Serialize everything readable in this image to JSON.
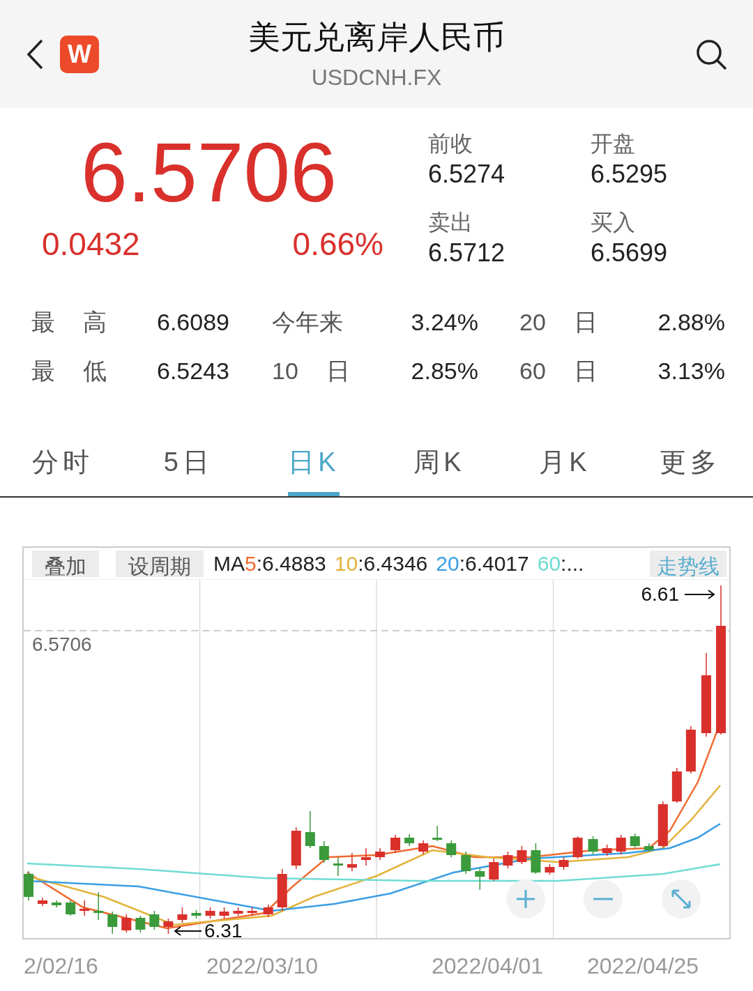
{
  "header": {
    "title": "美元兑离岸人民币",
    "subtitle": "USDCNH.FX",
    "logo": "W"
  },
  "quote": {
    "price": "6.5706",
    "change": "0.0432",
    "change_pct": "0.66%",
    "rising": true,
    "fields": [
      {
        "label": "前收",
        "value": "6.5274"
      },
      {
        "label": "开盘",
        "value": "6.5295"
      },
      {
        "label": "卖出",
        "value": "6.5712"
      },
      {
        "label": "买入",
        "value": "6.5699"
      }
    ]
  },
  "stats": [
    {
      "label": "最 高",
      "value": "6.6089"
    },
    {
      "label": "今年来",
      "value": "3.24%"
    },
    {
      "label": "20 日",
      "value": "2.88%"
    },
    {
      "label": "最 低",
      "value": "6.5243"
    },
    {
      "label": "10 日",
      "value": "2.85%"
    },
    {
      "label": "60 日",
      "value": "3.13%"
    }
  ],
  "tabs": [
    {
      "label": "分时",
      "selected": false
    },
    {
      "label": "5日",
      "selected": false
    },
    {
      "label": "日K",
      "selected": true
    },
    {
      "label": "周K",
      "selected": false
    },
    {
      "label": "月K",
      "selected": false
    },
    {
      "label": "更多",
      "selected": false
    }
  ],
  "chart": {
    "buttons": [
      "叠加",
      "设周期"
    ],
    "ma_prefix": "MA",
    "ma": [
      {
        "period": "5",
        "value": ":6.4883",
        "color": "#f06a30"
      },
      {
        "period": "10",
        "value": ":6.4346",
        "color": "#e2b33c"
      },
      {
        "period": "20",
        "value": ":6.4017",
        "color": "#3a9ee4"
      },
      {
        "period": "60",
        "value": ":...",
        "color": "#6fdcd2"
      }
    ],
    "trend_button": "走势线",
    "last_price": "6.5706",
    "high_mark": "6.61",
    "low_mark": "6.31",
    "dates": [
      "2/02/16",
      "2022/03/10",
      "2022/04/01",
      "2022/04/25"
    ]
  }
}
